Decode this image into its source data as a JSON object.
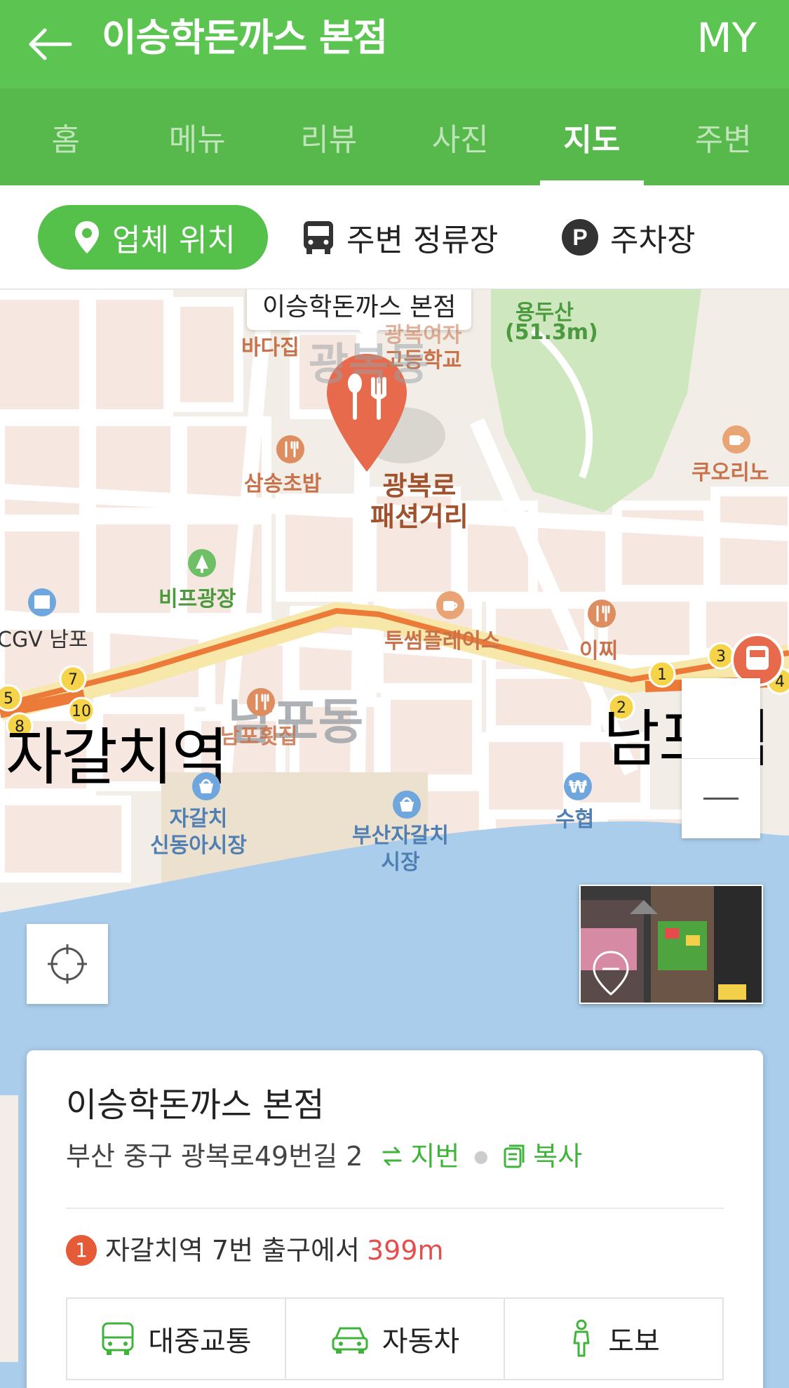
{
  "header": {
    "title": "이승학돈까스 본점",
    "my_label": "MY"
  },
  "tabs": [
    {
      "label": "홈",
      "active": false
    },
    {
      "label": "메뉴",
      "active": false
    },
    {
      "label": "리뷰",
      "active": false
    },
    {
      "label": "사진",
      "active": false
    },
    {
      "label": "지도",
      "active": true
    },
    {
      "label": "주변",
      "active": false
    }
  ],
  "filters": {
    "business_location": "업체 위치",
    "nearby_stops": "주변 정류장",
    "parking": "주차장",
    "parking_symbol": "P"
  },
  "map": {
    "callout": "이승학돈까스 본점",
    "labels": {
      "yongdusan": "용두산",
      "yongdusan_height": "(51.3m)",
      "badajip": "바다집",
      "school_a": "광복여자",
      "school_b": "고등학교",
      "district_top": "광복동",
      "samsong": "삼송초밥",
      "street_a": "광복로",
      "street_b": "패션거리",
      "qoolino": "쿠오리노",
      "bif": "비프광장",
      "cgv": "CGV 남포",
      "twosome": "투썸플레이스",
      "ijji": "이찌",
      "district_mid": "남포동",
      "hoetjip": "남포횟집",
      "jagalchi_station": "자갈치역",
      "nampo_station": "남포역",
      "shindong_a": "자갈치",
      "shindong_b": "신동아시장",
      "busan_jagalchi_a": "부산자갈치",
      "busan_jagalchi_b": "시장",
      "suhyup": "수협"
    },
    "exit_numbers": [
      "5",
      "7",
      "8",
      "10",
      "1",
      "2",
      "3",
      "4"
    ],
    "zoom_minus": "−"
  },
  "card": {
    "name": "이승학돈까스 본점",
    "address": "부산 중구 광복로49번길 2",
    "jibun_label": "지번",
    "copy_label": "복사",
    "station_num": "1",
    "station_text": "자갈치역 7번 출구에서",
    "distance": "399m",
    "routes": {
      "transit": "대중교통",
      "car": "자동차",
      "walk": "도보"
    }
  },
  "colors": {
    "brand_green": "#5cc552",
    "tab_green": "#57b94b",
    "accent_red": "#e54e4e",
    "pin_orange": "#e86a4c"
  }
}
